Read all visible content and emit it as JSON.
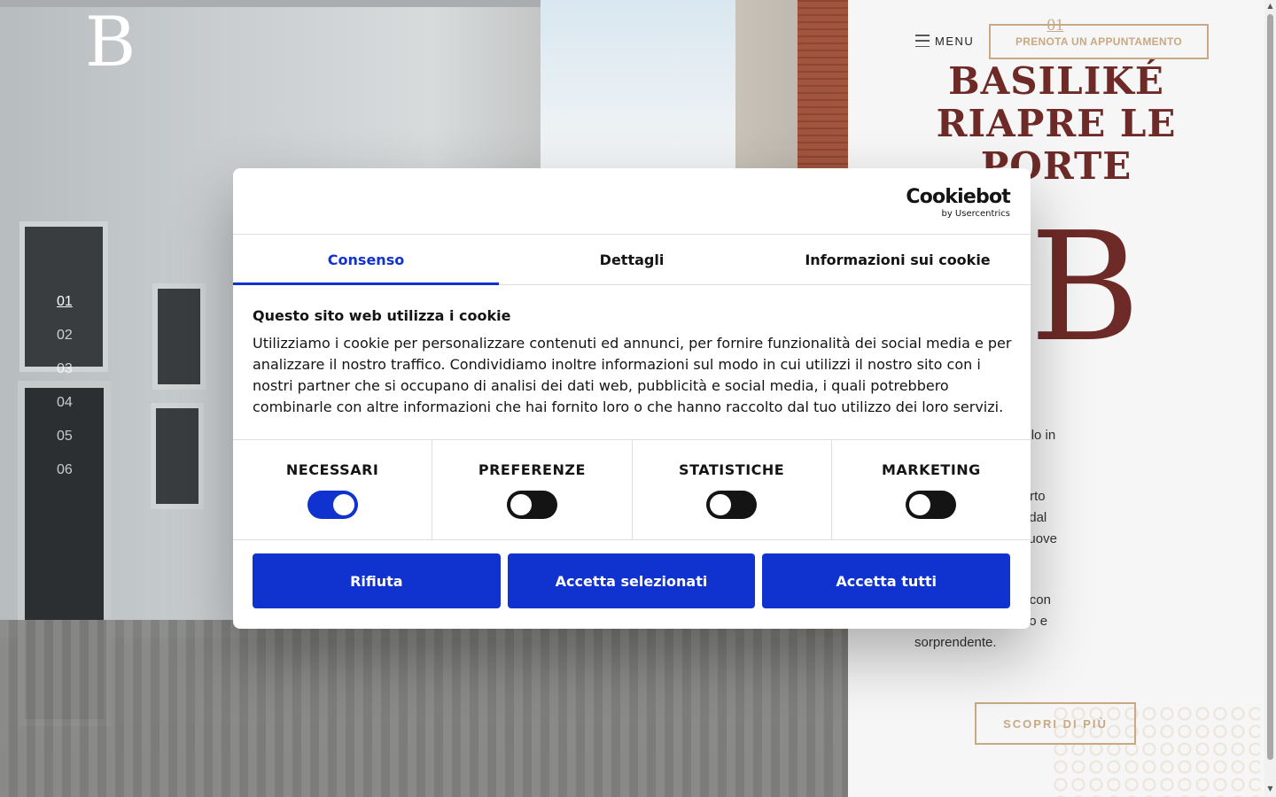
{
  "hero": {
    "logo": "B",
    "slides": [
      "01",
      "02",
      "03",
      "04",
      "05",
      "06"
    ]
  },
  "header": {
    "menu_label": "MENU",
    "cta_label": "PRENOTA UN APPUNTAMENTO",
    "slide_number": "01"
  },
  "content": {
    "headline": "BASILIKÉ RIAPRE LE PORTE",
    "mark": "B",
    "paragraph_1": "mpo si è fermato solo in",
    "paragraph_2": "use abbiamo scoperto\nalorizzato elementi dal\nasciato emergere nuove\ngetto.",
    "paragraph_3": "fficio vendite riapre con\na più ricco, autentico e\nsorprendente.",
    "discover_label": "SCOPRI DI PIÙ"
  },
  "cookie_dialog": {
    "brand_main": "Cookiebot",
    "brand_sub": "by Usercentrics",
    "tabs": [
      "Consenso",
      "Dettagli",
      "Informazioni sui cookie"
    ],
    "active_tab": "Consenso",
    "title": "Questo sito web utilizza i cookie",
    "text": "Utilizziamo i cookie per personalizzare contenuti ed annunci, per fornire funzionalità dei social media e per analizzare il nostro traffico. Condividiamo inoltre informazioni sul modo in cui utilizzi il nostro sito con i nostri partner che si occupano di analisi dei dati web, pubblicità e social media, i quali potrebbero combinarle con altre informazioni che hai fornito loro o che hanno raccolto dal tuo utilizzo dei loro servizi.",
    "categories": [
      {
        "label": "NECESSARI",
        "enabled": true
      },
      {
        "label": "PREFERENZE",
        "enabled": false
      },
      {
        "label": "STATISTICHE",
        "enabled": false
      },
      {
        "label": "MARKETING",
        "enabled": false
      }
    ],
    "buttons": [
      "Rifiuta",
      "Accetta selezionati",
      "Accetta tutti"
    ]
  },
  "colors": {
    "accent_blue": "#1032cf",
    "brand_burgundy": "#6e2a26",
    "gold": "#c8a983"
  }
}
